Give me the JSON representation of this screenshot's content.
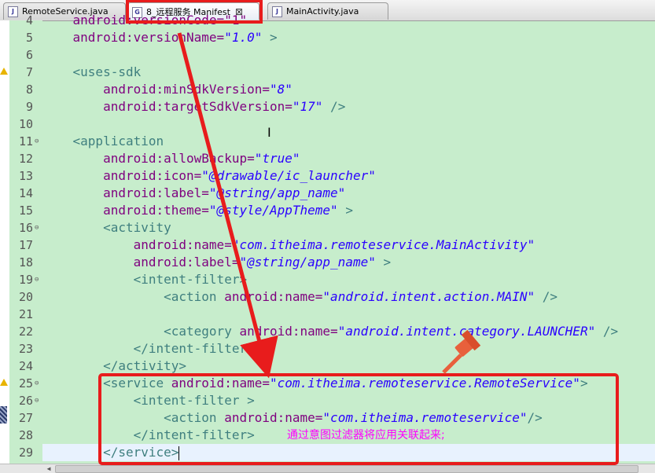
{
  "tabs": [
    {
      "icon": "java-file-icon",
      "icon_text": "J",
      "label": "RemoteService.java",
      "active": false
    },
    {
      "icon": "manifest-file-icon",
      "icon_text": "G",
      "label": "8_远程服务 Manifest",
      "active": true,
      "closable": true
    },
    {
      "icon": "java-file-icon",
      "icon_text": "J",
      "label": "MainActivity.java",
      "active": false
    }
  ],
  "line_numbers": [
    "4",
    "5",
    "6",
    "7",
    "8",
    "9",
    "10",
    "11",
    "12",
    "13",
    "14",
    "15",
    "16",
    "17",
    "18",
    "19",
    "20",
    "21",
    "22",
    "23",
    "24",
    "25",
    "26",
    "27",
    "28",
    "29"
  ],
  "code": {
    "l4": "    android:versionCode=\"1\"",
    "l5_attr": "    android:versionName=",
    "l5_val": "\"1.0\"",
    "l5_end": " >",
    "l7_tag": "    <uses-sdk",
    "l8_attr": "        android:minSdkVersion=",
    "l8_val": "\"8\"",
    "l9_attr": "        android:targetSdkVersion=",
    "l9_val": "\"17\"",
    "l9_end": " />",
    "l11_tag": "    <application",
    "l12_attr": "        android:allowBackup=",
    "l12_val": "\"true\"",
    "l13_attr": "        android:icon=",
    "l13_val": "\"@drawable/ic_launcher\"",
    "l14_attr": "        android:label=",
    "l14_val": "\"@string/app_name\"",
    "l15_attr": "        android:theme=",
    "l15_val": "\"@style/AppTheme\"",
    "l15_end": " >",
    "l16_tag": "        <activity",
    "l17_attr": "            android:name=",
    "l17_val": "\"com.itheima.remoteservice.MainActivity\"",
    "l18_attr": "            android:label=",
    "l18_val": "\"@string/app_name\"",
    "l18_end": " >",
    "l19_tag": "            <intent-filter>",
    "l20_tag": "                <action",
    "l20_attr": " android:name=",
    "l20_val": "\"android.intent.action.MAIN\"",
    "l20_end": " />",
    "l22_tag": "                <category",
    "l22_attr": " android:name=",
    "l22_val": "\"android.intent.category.LAUNCHER\"",
    "l22_end": " />",
    "l23_tag": "            </intent-filter>",
    "l24_tag": "        </activity>",
    "l25_tag": "        <service",
    "l25_attr": " android:name=",
    "l25_val": "\"com.itheima.remoteservice.RemoteService\"",
    "l25_end": ">",
    "l26_tag": "            <intent-filter",
    "l26_end": " >",
    "l27_tag": "                <action",
    "l27_attr": " android:name=",
    "l27_val": "\"com.itheima.remoteservice\"",
    "l27_end": "/>",
    "l28_tag": "            </intent-filter>",
    "l29_tag": "        </service>"
  },
  "annotation": "通过意图过滤器将应用关联起来;",
  "colors": {
    "editor_bg": "#c7edcc",
    "tag": "#3f7f7f",
    "attribute": "#7f007f",
    "value": "#2a00ff",
    "highlight": "#e81c1c",
    "annotation": "#ff00ff",
    "pin": "#e8603c"
  }
}
